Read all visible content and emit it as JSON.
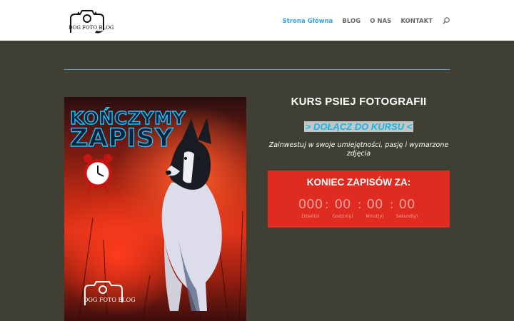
{
  "header": {
    "logo_text": "DOG FOTO BLOG",
    "nav": [
      {
        "label": "Strona Główna",
        "active": true
      },
      {
        "label": "BLOG",
        "active": false
      },
      {
        "label": "O NAS",
        "active": false
      },
      {
        "label": "KONTAKT",
        "active": false
      }
    ]
  },
  "poster": {
    "headline_line1": "KOŃCZYMY",
    "headline_line2": "ZAPISY",
    "logo_text": "DOG FOTO BLOG"
  },
  "course": {
    "title": "KURS PSIEJ FOTOGRAFII",
    "join_link": "> DOŁĄCZ DO KURSU <",
    "tagline": "Zainwestuj w swoje umiejętności, pasję i wymarzone zdjęcia"
  },
  "countdown": {
    "title": "KONIEC ZAPISÓW ZA:",
    "units": [
      {
        "value": "000",
        "label": "Dzień(s)"
      },
      {
        "value": "00",
        "label": "Godzin(y)"
      },
      {
        "value": "00",
        "label": "Minut(y)"
      },
      {
        "value": "00",
        "label": "Sekund(y)"
      }
    ],
    "separator": ":"
  },
  "colors": {
    "page_bg": "#3f3f33",
    "accent": "#2ea3f2",
    "link_cyan": "#1fc4f0",
    "countdown_bg": "#e02b20"
  }
}
